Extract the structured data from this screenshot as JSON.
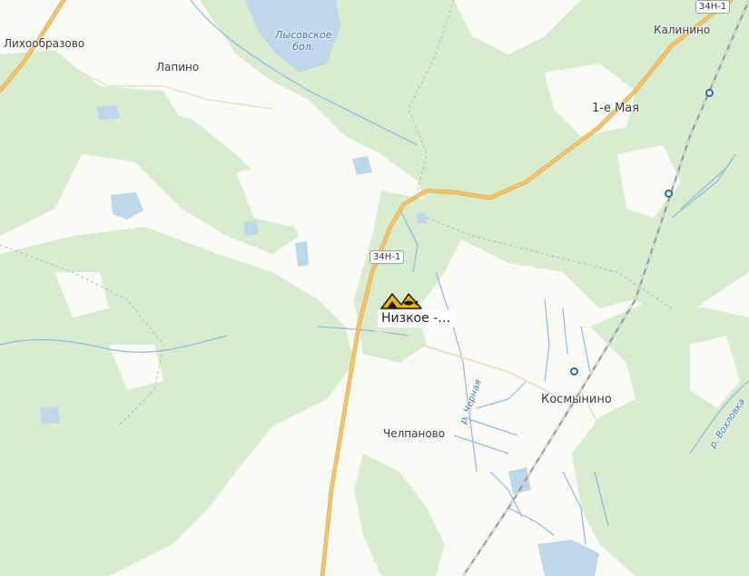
{
  "map": {
    "colors": {
      "forest": "#d8ecd0",
      "open_land": "#fbfbf6",
      "water": "#bcd8ea",
      "road": "#f6c56a",
      "rail": "#9a9a9a",
      "river": "#8fb9de"
    },
    "settlements": [
      {
        "id": "lihoobrazovo",
        "label": "Лихообразово"
      },
      {
        "id": "lapino",
        "label": "Лапино"
      },
      {
        "id": "kalinino",
        "label": "Калинино"
      },
      {
        "id": "pervoe-maya",
        "label": "1-е Мая"
      },
      {
        "id": "kosmynino",
        "label": "Космынино"
      },
      {
        "id": "chelpanovo",
        "label": "Челпаново"
      }
    ],
    "water_label": {
      "line1": "Лысовское",
      "line2": "бол."
    },
    "rivers": [
      {
        "id": "chernaya",
        "label": "р. Черная"
      },
      {
        "id": "vokhlovka",
        "label": "р. Вохловка"
      }
    ],
    "road_shields": [
      {
        "id": "shield-top-right",
        "label": "34Н-1"
      },
      {
        "id": "shield-center",
        "label": "34Н-1"
      }
    ],
    "poi": {
      "label": "Низкое -…",
      "icon": "fish-farm-icon"
    }
  }
}
